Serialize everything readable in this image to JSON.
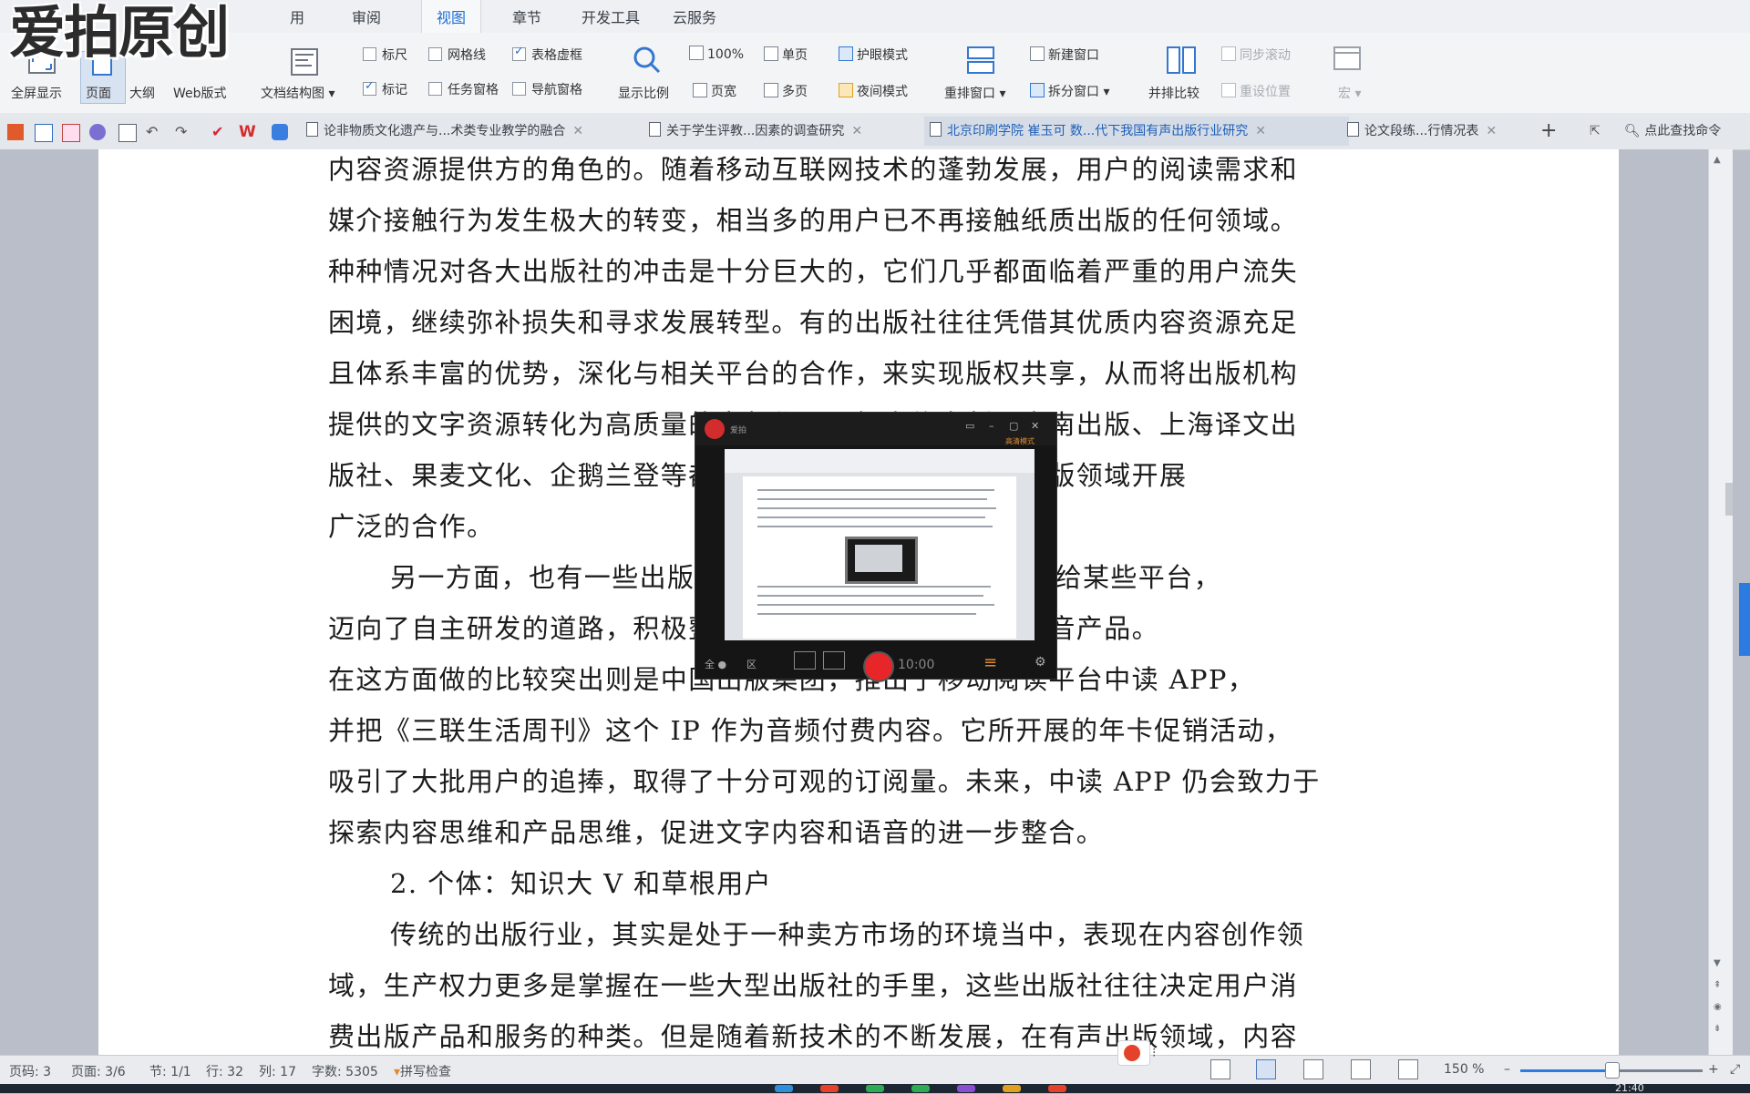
{
  "watermark": {
    "text": "爱拍原创"
  },
  "ribbon": {
    "tabs": [
      "用",
      "审阅",
      "视图",
      "章节",
      "开发工具",
      "云服务"
    ],
    "active_tab": "视图",
    "view_buttons": [
      "全屏显示",
      "页面",
      "大纲",
      "Web版式"
    ],
    "doc_structure": "文档结构图 ▾",
    "checks_row1": [
      {
        "label": "标尺",
        "checked": false
      },
      {
        "label": "网格线",
        "checked": false
      },
      {
        "label": "表格虚框",
        "checked": true
      }
    ],
    "checks_row2": [
      {
        "label": "标记",
        "checked": true
      },
      {
        "label": "任务窗格",
        "checked": false
      },
      {
        "label": "导航窗格",
        "checked": false
      }
    ],
    "zoom_label": "显示比例",
    "zoom_100": "100%",
    "single_page": "单页",
    "page_width": "页宽",
    "multi_page": "多页",
    "eye_mode": "护眼模式",
    "night_mode": "夜间模式",
    "rearrange": "重排窗口 ▾",
    "new_window": "新建窗口",
    "split_window": "拆分窗口 ▾",
    "side_by_side": "并排比较",
    "sync_scroll": "同步滚动",
    "reset_pos": "重设位置",
    "macro": "宏 ▾"
  },
  "doc_tabs": [
    {
      "label": "论非物质文化遗产与...术类专业教学的融合",
      "active": false
    },
    {
      "label": "关于学生评教...因素的调查研究",
      "active": false
    },
    {
      "label": "北京印刷学院 崔玉可 数...代下我国有声出版行业研究",
      "active": true
    },
    {
      "label": "论文段练...行情况表",
      "active": false
    }
  ],
  "search_command": "点此查找命令",
  "document": {
    "lines": [
      {
        "text": "内容资源提供方的角色的。随着移动互联网技术的蓬勃发展，用户的阅读需求和",
        "indent": false
      },
      {
        "text": "媒介接触行为发生极大的转变，相当多的用户已不再接触纸质出版的任何领域。",
        "indent": false
      },
      {
        "text": "种种情况对各大出版社的冲击是十分巨大的，它们几乎都面临着严重的用户流失",
        "indent": false
      },
      {
        "text": "困境，继续弥补损失和寻求发展转型。有的出版社往往凭借其优质内容资源充足",
        "indent": false
      },
      {
        "text": "且体系丰富的优势，深化与相关平台的合作，来实现版权共享，从而将出版机构",
        "indent": false
      },
      {
        "text": "提供的文字资源转化为高质量的音频作品，如中信出版、中南出版、上海译文出",
        "indent": false
      },
      {
        "text": "版社、果麦文化、企鹅兰登等都与相关平台签约，在有声出版领域开展",
        "indent": false
      },
      {
        "text": "广泛的合作。",
        "indent": false
      },
      {
        "text": "另一方面，也有一些出版社不再将自己的内容资源让渡给某些平台，",
        "indent": true
      },
      {
        "text": "迈向了自主研发的道路，积极整合内容资源，制作优质的语音产品。",
        "indent": false
      },
      {
        "text": "在这方面做的比较突出则是中国出版集团，推出了移动阅读平台中读 APP，",
        "indent": false
      },
      {
        "text": "并把《三联生活周刊》这个 IP 作为音频付费内容。它所开展的年卡促销活动，",
        "indent": false
      },
      {
        "text": "吸引了大批用户的追捧，取得了十分可观的订阅量。未来，中读 APP 仍会致力于",
        "indent": false
      },
      {
        "text": "探索内容思维和产品思维，促进文字内容和语音的进一步整合。",
        "indent": false
      },
      {
        "text": "2. 个体：知识大 V 和草根用户",
        "indent": true
      },
      {
        "text": "传统的出版行业，其实是处于一种卖方市场的环境当中，表现在内容创作领",
        "indent": true
      },
      {
        "text": "域，生产权力更多是掌握在一些大型出版社的手里，这些出版社往往决定用户消",
        "indent": false
      },
      {
        "text": "费出版产品和服务的种类。但是随着新技术的不断发展，在有声出版领域，内容",
        "indent": false
      }
    ]
  },
  "recorder": {
    "title": "爱拍",
    "time": "10:00",
    "status_badge": "高清模式"
  },
  "status_bar": {
    "page_num": "页码: 3",
    "pages": "页面: 3/6",
    "section": "节: 1/1",
    "row": "行: 32",
    "col": "列: 17",
    "word_count": "字数: 5305",
    "spell_check": "拼写检查",
    "zoom": "150 %",
    "zoom_fraction": 0.5
  },
  "taskbar": {
    "clock": "21:40"
  },
  "colors": {
    "accent": "#1d6fd6",
    "record_red": "#e8262a",
    "side_tab": "#2b7be0"
  }
}
